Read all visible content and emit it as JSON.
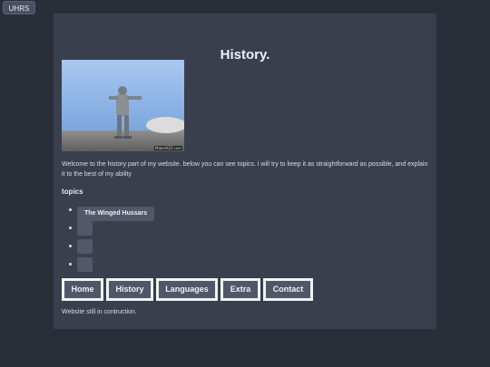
{
  "corner_button": {
    "label": "UHRS"
  },
  "page": {
    "title": "History.",
    "image": {
      "watermark": "MakeAGIF.com"
    },
    "intro": "Welcome to the history part of my website. below you can see topics. i will try to keep it as straightforward as possible, and explain it to the best of my ability",
    "topics_heading": "topics",
    "topics": [
      {
        "label": "The Winged Hussars"
      },
      {
        "label": ""
      },
      {
        "label": ""
      },
      {
        "label": ""
      }
    ],
    "nav": [
      {
        "label": "Home"
      },
      {
        "label": "History"
      },
      {
        "label": "Languages"
      },
      {
        "label": "Extra"
      },
      {
        "label": "Contact"
      }
    ],
    "footer": "Website still in contruction."
  },
  "colors": {
    "background": "#2a2e39",
    "panel": "#3a3f4e",
    "button": "#505768",
    "button_border": "#f2f2f2"
  }
}
